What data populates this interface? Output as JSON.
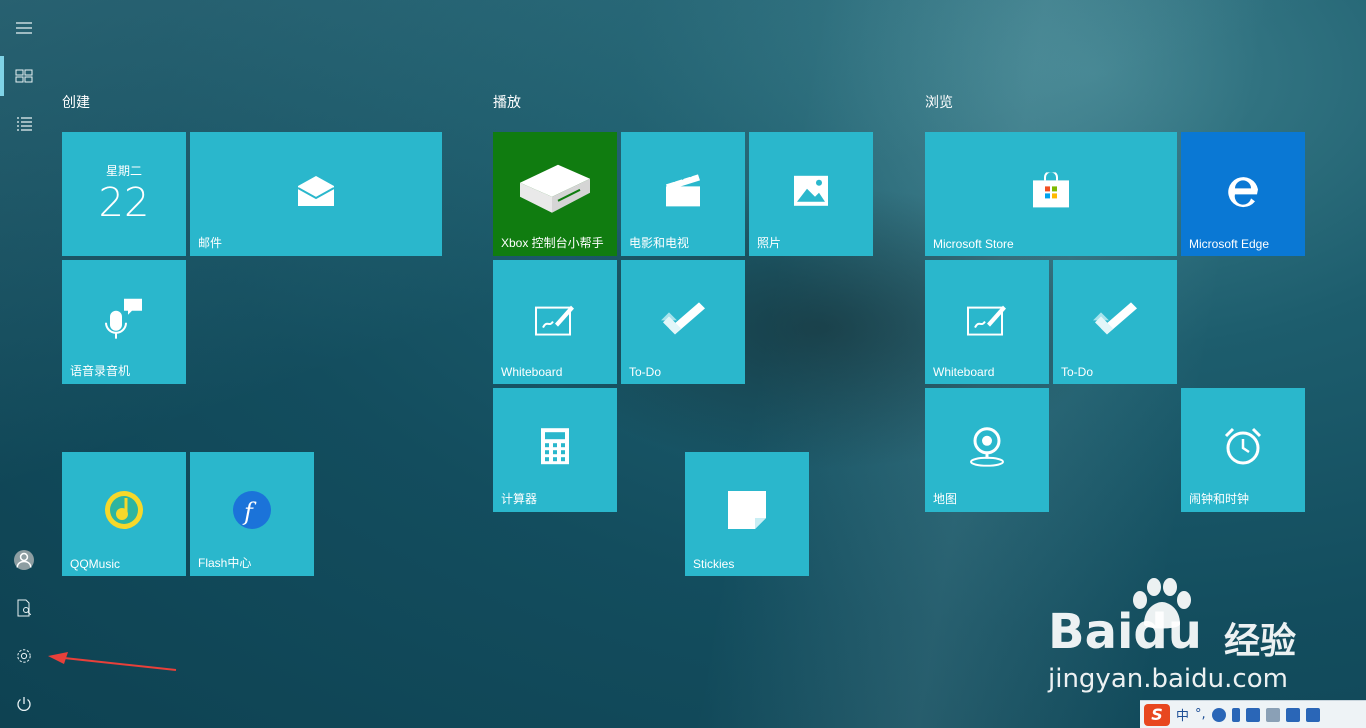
{
  "sidebar": {
    "items": [
      {
        "name": "hamburger-menu"
      },
      {
        "name": "pinned-tiles",
        "active": true
      },
      {
        "name": "all-apps-list"
      },
      {
        "name": "user-account"
      },
      {
        "name": "documents"
      },
      {
        "name": "settings"
      },
      {
        "name": "power"
      }
    ]
  },
  "groups": {
    "create": {
      "title": "创建"
    },
    "play": {
      "title": "播放"
    },
    "explore": {
      "title": "浏览"
    }
  },
  "tiles": {
    "calendar": {
      "day": "星期二",
      "date": "22"
    },
    "mail": {
      "label": "邮件"
    },
    "voice_recorder": {
      "label": "语音录音机"
    },
    "qqmusic": {
      "label": "QQMusic"
    },
    "flash": {
      "label": "Flash中心"
    },
    "xbox": {
      "label": "Xbox 控制台小帮手"
    },
    "movies": {
      "label": "电影和电视"
    },
    "photos": {
      "label": "照片"
    },
    "whiteboard1": {
      "label": "Whiteboard"
    },
    "todo1": {
      "label": "To-Do"
    },
    "calculator": {
      "label": "计算器"
    },
    "stickies": {
      "label": "Stickies"
    },
    "store": {
      "label": "Microsoft Store"
    },
    "edge": {
      "label": "Microsoft Edge"
    },
    "whiteboard2": {
      "label": "Whiteboard"
    },
    "todo2": {
      "label": "To-Do"
    },
    "maps": {
      "label": "地图"
    },
    "alarms": {
      "label": "闹钟和时钟"
    }
  },
  "watermark": {
    "brand": "Baidu",
    "brand_cn": "经验",
    "url": "jingyan.baidu.com"
  },
  "ime": {
    "logo": "S",
    "lang": "中",
    "punct": "°,"
  },
  "colors": {
    "tile": "#2ab7cc",
    "xbox": "#107c10",
    "edge": "#0a78d4",
    "arrow": "#e8403a"
  }
}
